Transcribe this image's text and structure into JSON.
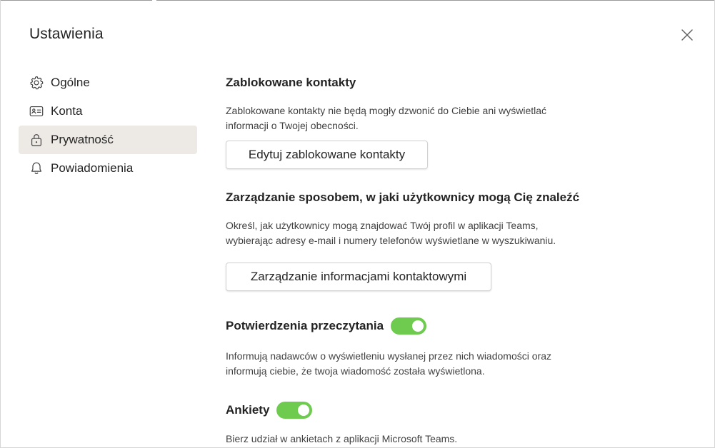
{
  "dialog": {
    "title": "Ustawienia"
  },
  "sidebar": {
    "items": [
      {
        "label": "Ogólne",
        "icon": "gear-icon",
        "active": false
      },
      {
        "label": "Konta",
        "icon": "id-card-icon",
        "active": false
      },
      {
        "label": "Prywatność",
        "icon": "lock-icon",
        "active": true
      },
      {
        "label": "Powiadomienia",
        "icon": "bell-icon",
        "active": false
      }
    ]
  },
  "privacy": {
    "blocked": {
      "heading": "Zablokowane kontakty",
      "description": "Zablokowane kontakty nie będą mogły dzwonić do Ciebie ani wyświetlać informacji o Twojej obecności.",
      "button_label": "Edytuj zablokowane kontakty"
    },
    "discoverability": {
      "heading": "Zarządzanie sposobem, w jaki użytkownicy mogą Cię znaleźć",
      "description": "Określ, jak użytkownicy mogą znajdować Twój profil w aplikacji Teams, wybierając adresy e-mail i numery telefonów wyświetlane w wyszukiwaniu.",
      "button_label": "Zarządzanie informacjami kontaktowymi"
    },
    "read_receipts": {
      "label": "Potwierdzenia przeczytania",
      "enabled": true,
      "description": "Informują nadawców o wyświetleniu wysłanej przez nich wiadomości oraz informują ciebie, że twoja wiadomość została wyświetlona."
    },
    "surveys": {
      "label": "Ankiety",
      "enabled": true,
      "description": "Bierz udział w ankietach z aplikacji Microsoft Teams."
    }
  },
  "colors": {
    "toggle_on": "#6fcb4f",
    "active_nav_bg": "#ede9e5"
  }
}
